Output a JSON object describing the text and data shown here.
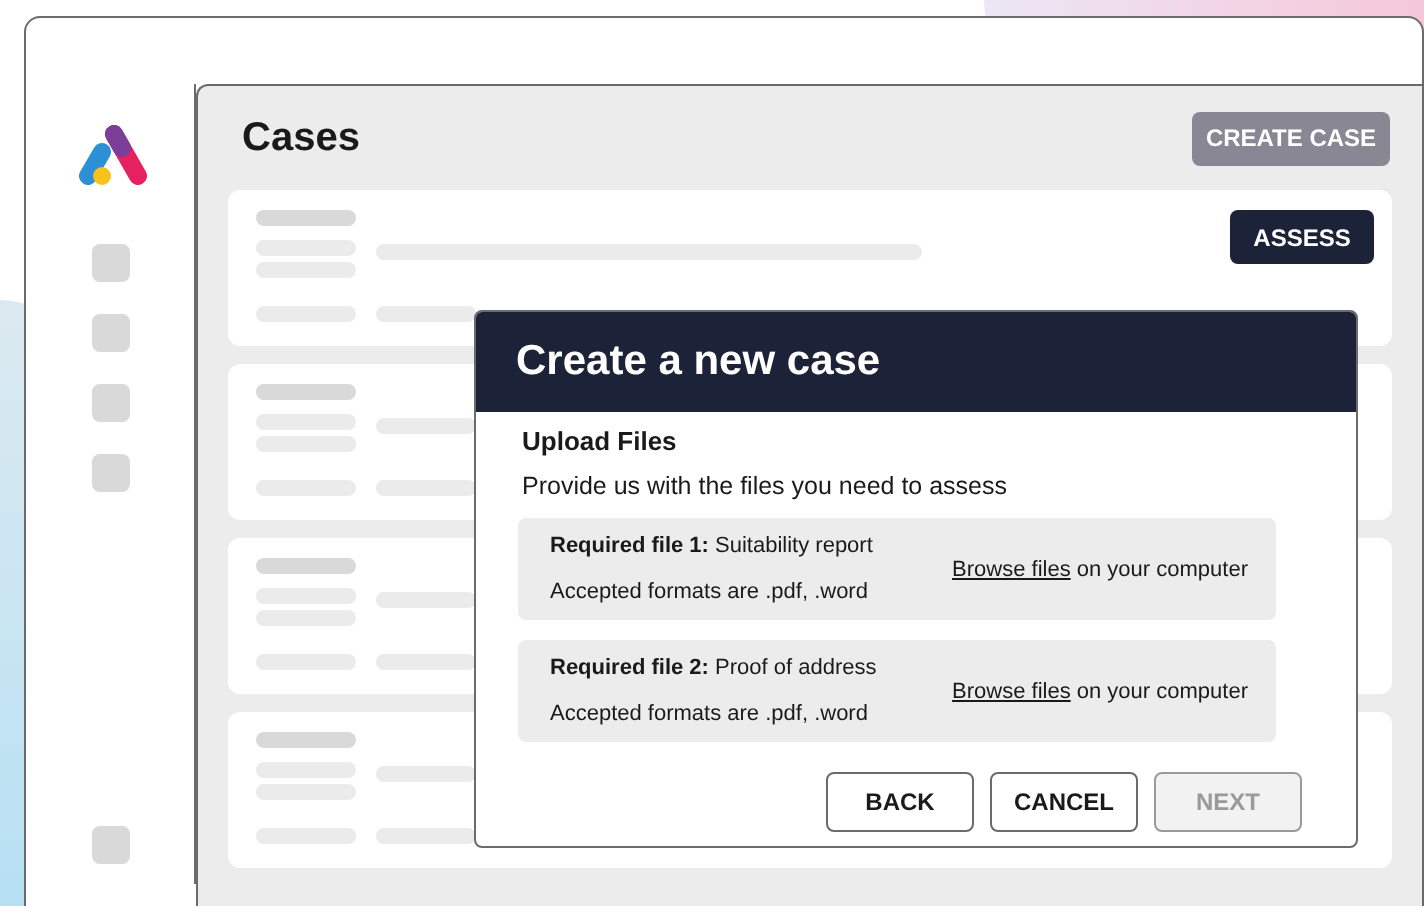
{
  "page": {
    "title": "Cases",
    "create_button": "CREATE CASE",
    "assess_button": "ASSESS"
  },
  "modal": {
    "title": "Create a new case",
    "section_title": "Upload Files",
    "description": "Provide us with the files you need to assess",
    "files": [
      {
        "requirement": "**Required file 1:** Suitability report",
        "formats": "Accepted formats are .pdf, .word",
        "browse_link": "Browse files",
        "browse_suffix": "on your computer"
      },
      {
        "requirement": "**Required file 2:** Proof of address",
        "formats": "Accepted formats are .pdf, .word",
        "browse_link": "Browse files",
        "browse_suffix": "on your computer"
      }
    ],
    "buttons": [
      {
        "label": "BACK",
        "disabled": false
      },
      {
        "label": "CANCEL",
        "disabled": false
      },
      {
        "label": "NEXT",
        "disabled": true
      }
    ]
  }
}
